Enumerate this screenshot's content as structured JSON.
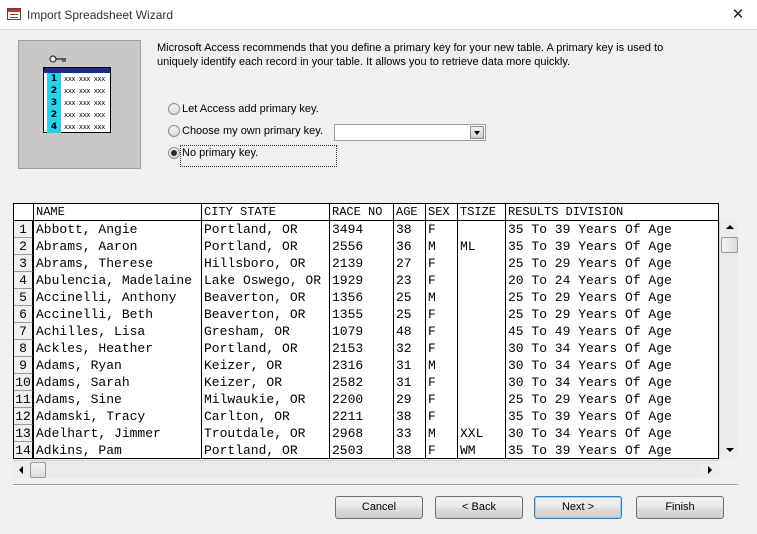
{
  "window": {
    "title": "Import Spreadsheet Wizard",
    "close_glyph": "✕"
  },
  "illustration": {
    "rows": [
      {
        "num": "1",
        "cells": "xxx xxx xxx"
      },
      {
        "num": "2",
        "cells": "xxx xxx xxx"
      },
      {
        "num": "3",
        "cells": "xxx xxx xxx"
      },
      {
        "num": "2",
        "cells": "xxx xxx xxx"
      },
      {
        "num": "4",
        "cells": "xxx xxx xxx"
      }
    ]
  },
  "description": "Microsoft Access recommends that you define a primary key for your new table. A primary key is used to uniquely identify each record in your table. It allows you to retrieve data more quickly.",
  "options": {
    "let_access": "Let Access add primary key.",
    "choose_own": "Choose my own primary key.",
    "no_key": "No primary key.",
    "selected": "no_key",
    "field_value": ""
  },
  "grid": {
    "columns": [
      "NAME",
      "CITY STATE",
      "RACE NO",
      "AGE",
      "SEX",
      "TSIZE",
      "RESULTS DIVISION"
    ],
    "rows": [
      [
        "1",
        "Abbott, Angie",
        "Portland, OR",
        "3494",
        "38",
        "F",
        "",
        "35 To 39 Years Of Age"
      ],
      [
        "2",
        "Abrams, Aaron",
        "Portland, OR",
        "2556",
        "36",
        "M",
        "ML",
        "35 To 39 Years Of Age"
      ],
      [
        "3",
        "Abrams, Therese",
        "Hillsboro, OR",
        "2139",
        "27",
        "F",
        "",
        "25 To 29 Years Of Age"
      ],
      [
        "4",
        "Abulencia, Madelaine",
        "Lake Oswego, OR",
        "1929",
        "23",
        "F",
        "",
        "20 To 24 Years Of Age"
      ],
      [
        "5",
        "Accinelli, Anthony",
        "Beaverton, OR",
        "1356",
        "25",
        "M",
        "",
        "25 To 29 Years Of Age"
      ],
      [
        "6",
        "Accinelli, Beth",
        "Beaverton, OR",
        "1355",
        "25",
        "F",
        "",
        "25 To 29 Years Of Age"
      ],
      [
        "7",
        "Achilles, Lisa",
        "Gresham, OR",
        "1079",
        "48",
        "F",
        "",
        "45 To 49 Years Of Age"
      ],
      [
        "8",
        "Ackles, Heather",
        "Portland, OR",
        "2153",
        "32",
        "F",
        "",
        "30 To 34 Years Of Age"
      ],
      [
        "9",
        "Adams, Ryan",
        "Keizer, OR",
        "2316",
        "31",
        "M",
        "",
        "30 To 34 Years Of Age"
      ],
      [
        "10",
        "Adams, Sarah",
        "Keizer, OR",
        "2582",
        "31",
        "F",
        "",
        "30 To 34 Years Of Age"
      ],
      [
        "11",
        "Adams, Sine",
        "Milwaukie, OR",
        "2200",
        "29",
        "F",
        "",
        "25 To 29 Years Of Age"
      ],
      [
        "12",
        "Adamski, Tracy",
        "Carlton, OR",
        "2211",
        "38",
        "F",
        "",
        "35 To 39 Years Of Age"
      ],
      [
        "13",
        "Adelhart, Jimmer",
        "Troutdale, OR",
        "2968",
        "33",
        "M",
        "XXL",
        "30 To 34 Years Of Age"
      ],
      [
        "14",
        "Adkins, Pam",
        "Portland, OR",
        "2503",
        "38",
        "F",
        "WM",
        "35 To 39 Years Of Age"
      ]
    ]
  },
  "buttons": {
    "cancel": "Cancel",
    "back": "< Back",
    "next": "Next >",
    "finish": "Finish"
  }
}
